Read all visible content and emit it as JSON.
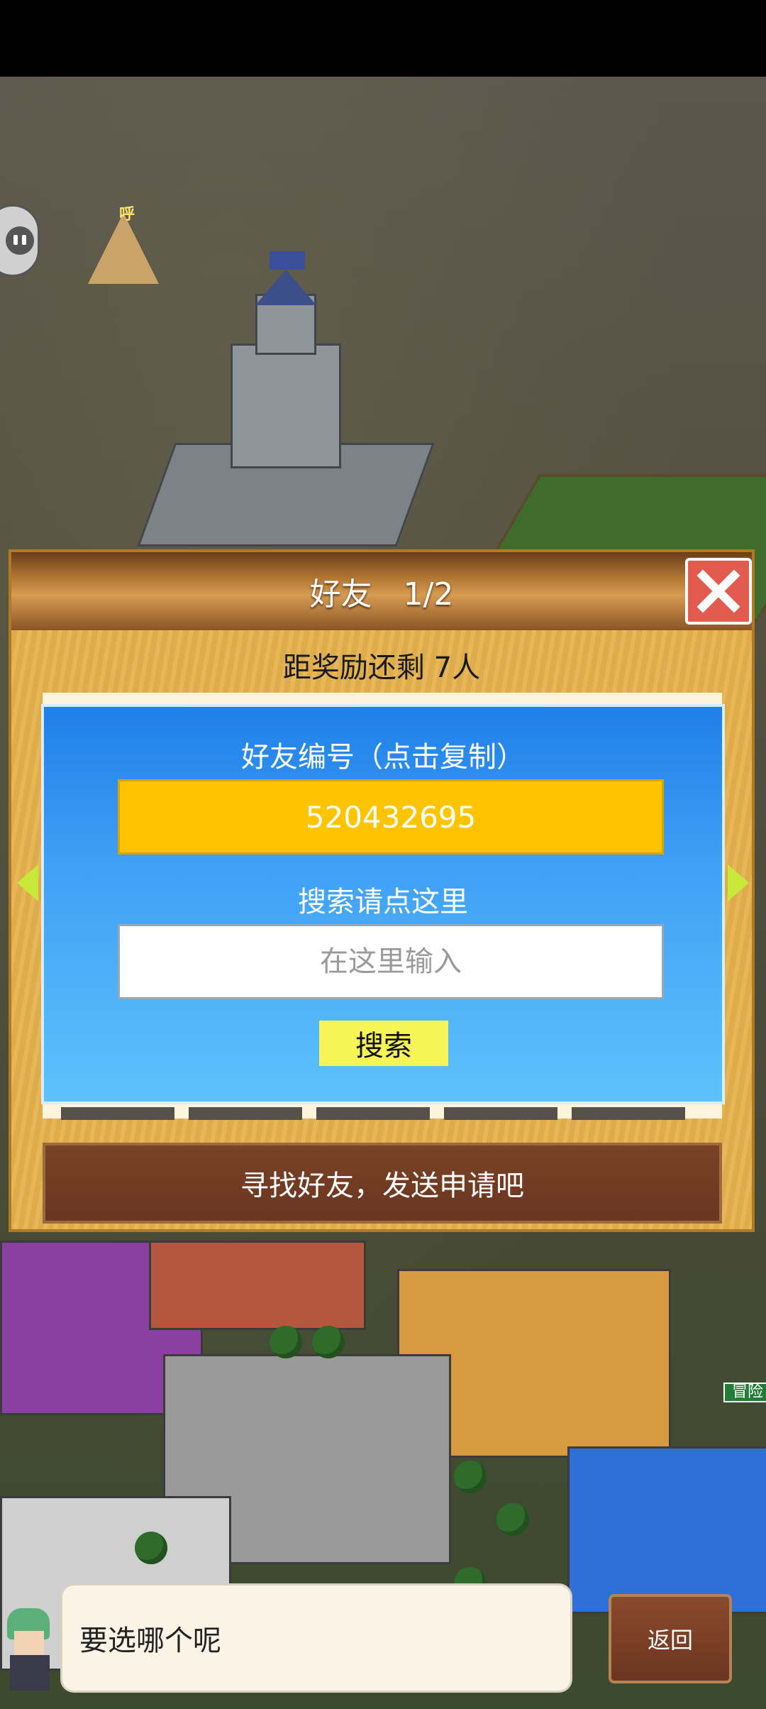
{
  "dialog": {
    "title": "好友　1/2",
    "reward_text": "距奖励还剩 7人",
    "friend_id_label": "好友编号（点击复制）",
    "friend_id_value": "520432695",
    "search_label": "搜索请点这里",
    "search_placeholder": "在这里输入",
    "search_value": "",
    "search_button_label": "搜索",
    "find_friends_label": "寻找好友，发送申请吧"
  },
  "world": {
    "tent_label": "呼",
    "adventure_tag": "冒险"
  },
  "bottom": {
    "speech_text": "要选哪个呢",
    "back_label": "返回"
  },
  "icons": {
    "close": "close-icon",
    "nav_left": "arrow-left-icon",
    "nav_right": "arrow-right-icon",
    "chat": "chat-face-icon"
  },
  "colors": {
    "close_button": "#e25b4e",
    "friend_id_bg": "#ffc400",
    "search_button_bg": "#f5f557",
    "panel_blue": "#3fa0f5",
    "find_friends_bg": "#7a4226"
  }
}
